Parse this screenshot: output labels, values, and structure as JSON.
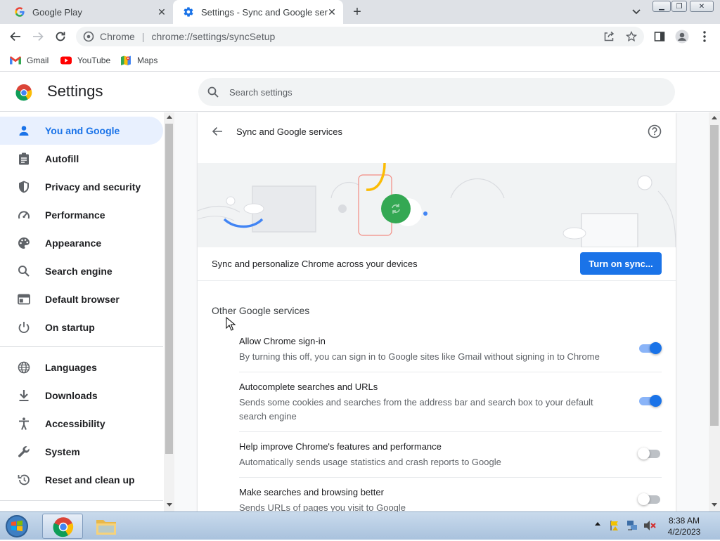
{
  "browser": {
    "tabs": [
      {
        "title": "Google Play",
        "favicon": "google-g-icon",
        "active": false
      },
      {
        "title": "Settings - Sync and Google servi",
        "favicon": "settings-gear-icon",
        "active": true
      }
    ],
    "address": {
      "host": "Chrome",
      "url": "chrome://settings/syncSetup"
    },
    "bookmarks": [
      {
        "label": "Gmail",
        "icon": "gmail-icon"
      },
      {
        "label": "YouTube",
        "icon": "youtube-icon"
      },
      {
        "label": "Maps",
        "icon": "maps-icon"
      }
    ]
  },
  "settings": {
    "title": "Settings",
    "search_placeholder": "Search settings",
    "sidebar": [
      {
        "label": "You and Google",
        "icon": "person-icon",
        "active": true
      },
      {
        "label": "Autofill",
        "icon": "clipboard-icon"
      },
      {
        "label": "Privacy and security",
        "icon": "shield-icon"
      },
      {
        "label": "Performance",
        "icon": "speedometer-icon"
      },
      {
        "label": "Appearance",
        "icon": "palette-icon"
      },
      {
        "label": "Search engine",
        "icon": "search-icon"
      },
      {
        "label": "Default browser",
        "icon": "browser-window-icon"
      },
      {
        "label": "On startup",
        "icon": "power-icon"
      },
      {
        "label": "Languages",
        "icon": "globe-icon"
      },
      {
        "label": "Downloads",
        "icon": "download-icon"
      },
      {
        "label": "Accessibility",
        "icon": "accessibility-icon"
      },
      {
        "label": "System",
        "icon": "wrench-icon"
      },
      {
        "label": "Reset and clean up",
        "icon": "reset-icon"
      }
    ]
  },
  "page": {
    "title": "Sync and Google services",
    "sync_text": "Sync and personalize Chrome across your devices",
    "sync_button": "Turn on sync...",
    "section_title": "Other Google services",
    "rows": [
      {
        "title": "Allow Chrome sign-in",
        "desc": "By turning this off, you can sign in to Google sites like Gmail without signing in to Chrome",
        "enabled": true
      },
      {
        "title": "Autocomplete searches and URLs",
        "desc": "Sends some cookies and searches from the address bar and search box to your default search engine",
        "enabled": true
      },
      {
        "title": "Help improve Chrome's features and performance",
        "desc": "Automatically sends usage statistics and crash reports to Google",
        "enabled": false
      },
      {
        "title": "Make searches and browsing better",
        "desc": "Sends URLs of pages you visit to Google",
        "enabled": false
      }
    ]
  },
  "taskbar": {
    "time": "8:38 AM",
    "date": "4/2/2023"
  },
  "colors": {
    "accent": "#1a73e8",
    "active_bg": "#e8f0fe",
    "sync_green": "#34a853"
  }
}
